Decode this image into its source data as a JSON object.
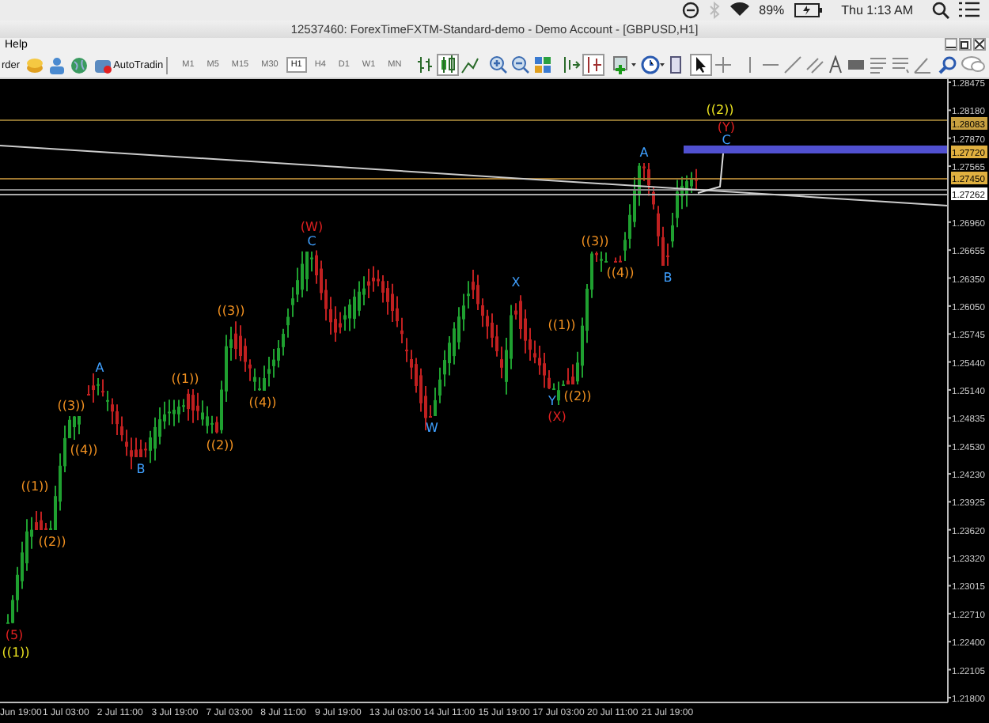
{
  "system_bar": {
    "battery": "89%",
    "clock": "Thu 1:13 AM"
  },
  "window": {
    "title": "12537460: ForexTimeFXTM-Standard-demo - Demo Account - [GBPUSD,H1]"
  },
  "menu": [
    "Help"
  ],
  "toolbar": {
    "order_button": "rder",
    "autotrading_button": "AutoTradin",
    "timeframes": [
      {
        "label": "M1",
        "selected": false
      },
      {
        "label": "M5",
        "selected": false
      },
      {
        "label": "M15",
        "selected": false
      },
      {
        "label": "M30",
        "selected": false
      },
      {
        "label": "H1",
        "selected": true
      },
      {
        "label": "H4",
        "selected": false
      },
      {
        "label": "D1",
        "selected": false
      },
      {
        "label": "W1",
        "selected": false
      },
      {
        "label": "MN",
        "selected": false
      }
    ]
  },
  "chart": {
    "price_axis": [
      "1.28475",
      "1.28180",
      "1.27870",
      "1.27565",
      "1.26960",
      "1.26655",
      "1.26350",
      "1.26050",
      "1.25745",
      "1.25440",
      "1.25140",
      "1.24835",
      "1.24530",
      "1.24230",
      "1.23925",
      "1.23620",
      "1.23320",
      "1.23015",
      "1.22710",
      "1.22400",
      "1.22105",
      "1.21800"
    ],
    "price_tags": [
      {
        "text": "1.28083",
        "color": "#c8a040"
      },
      {
        "text": "1.27720",
        "color": "#e0b040"
      },
      {
        "text": "1.27450",
        "color": "#e0b040"
      },
      {
        "text": "1.27262",
        "color": "#ffffff"
      }
    ],
    "time_axis": [
      "Jun 19:00",
      "1 Jul 03:00",
      "2 Jul 11:00",
      "3 Jul 19:00",
      "7 Jul 03:00",
      "8 Jul 11:00",
      "9 Jul 19:00",
      "13 Jul 03:00",
      "14 Jul 11:00",
      "15 Jul 19:00",
      "17 Jul 03:00",
      "20 Jul 11:00",
      "21 Jul 19:00"
    ],
    "wave_labels": [
      {
        "text": "((2))",
        "color": "#e8e020"
      },
      {
        "text": "(Y)",
        "color": "#e02020"
      },
      {
        "text": "C",
        "color": "#3fa0ff"
      },
      {
        "text": "A",
        "color": "#3fa0ff"
      },
      {
        "text": "(W)",
        "color": "#e02020"
      },
      {
        "text": "C",
        "color": "#3fa0ff"
      },
      {
        "text": "((3))",
        "color": "#f09020"
      },
      {
        "text": "((4))",
        "color": "#f09020"
      },
      {
        "text": "B",
        "color": "#3fa0ff"
      },
      {
        "text": "X",
        "color": "#3fa0ff"
      },
      {
        "text": "((3))",
        "color": "#f09020"
      },
      {
        "text": "((1))",
        "color": "#f09020"
      },
      {
        "text": "A",
        "color": "#3fa0ff"
      },
      {
        "text": "((1))",
        "color": "#f09020"
      },
      {
        "text": "((3))",
        "color": "#f09020"
      },
      {
        "text": "((4))",
        "color": "#f09020"
      },
      {
        "text": "((2))",
        "color": "#f09020"
      },
      {
        "text": "Y",
        "color": "#3fa0ff"
      },
      {
        "text": "(X)",
        "color": "#e02020"
      },
      {
        "text": "W",
        "color": "#3fa0ff"
      },
      {
        "text": "((4))",
        "color": "#f09020"
      },
      {
        "text": "((2))",
        "color": "#f09020"
      },
      {
        "text": "B",
        "color": "#3fa0ff"
      },
      {
        "text": "((1))",
        "color": "#f09020"
      },
      {
        "text": "((2))",
        "color": "#f09020"
      },
      {
        "text": "(5)",
        "color": "#e02020"
      },
      {
        "text": "((1))",
        "color": "#e8e020"
      }
    ]
  }
}
